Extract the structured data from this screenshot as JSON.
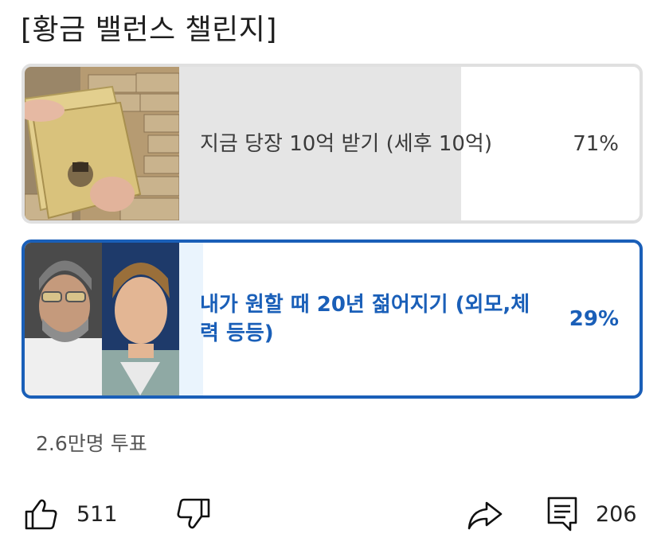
{
  "poll": {
    "title": "[황금 밸런스 챌린지]",
    "options": [
      {
        "label": "지금 당장 10억 받기 (세후 10억)",
        "percent_text": "71%",
        "percent": 71,
        "selected": false,
        "image_icon": "money-photo"
      },
      {
        "label": "내가 원할 때 20년 젊어지기 (외모,체력 등등)",
        "percent_text": "29%",
        "percent": 29,
        "selected": true,
        "image_icon": "actor-photo"
      }
    ],
    "vote_count": "2.6만명 투표"
  },
  "actions": {
    "like_count": "511",
    "comment_count": "206",
    "icons": [
      "thumbs-up-icon",
      "thumbs-down-icon",
      "share-icon",
      "comment-icon"
    ]
  },
  "colors": {
    "selected_accent": "#1a5fb8",
    "selected_fill": "#eaf4fd",
    "unselected_fill": "#e5e5e5",
    "unselected_border": "#e0e0e0"
  }
}
